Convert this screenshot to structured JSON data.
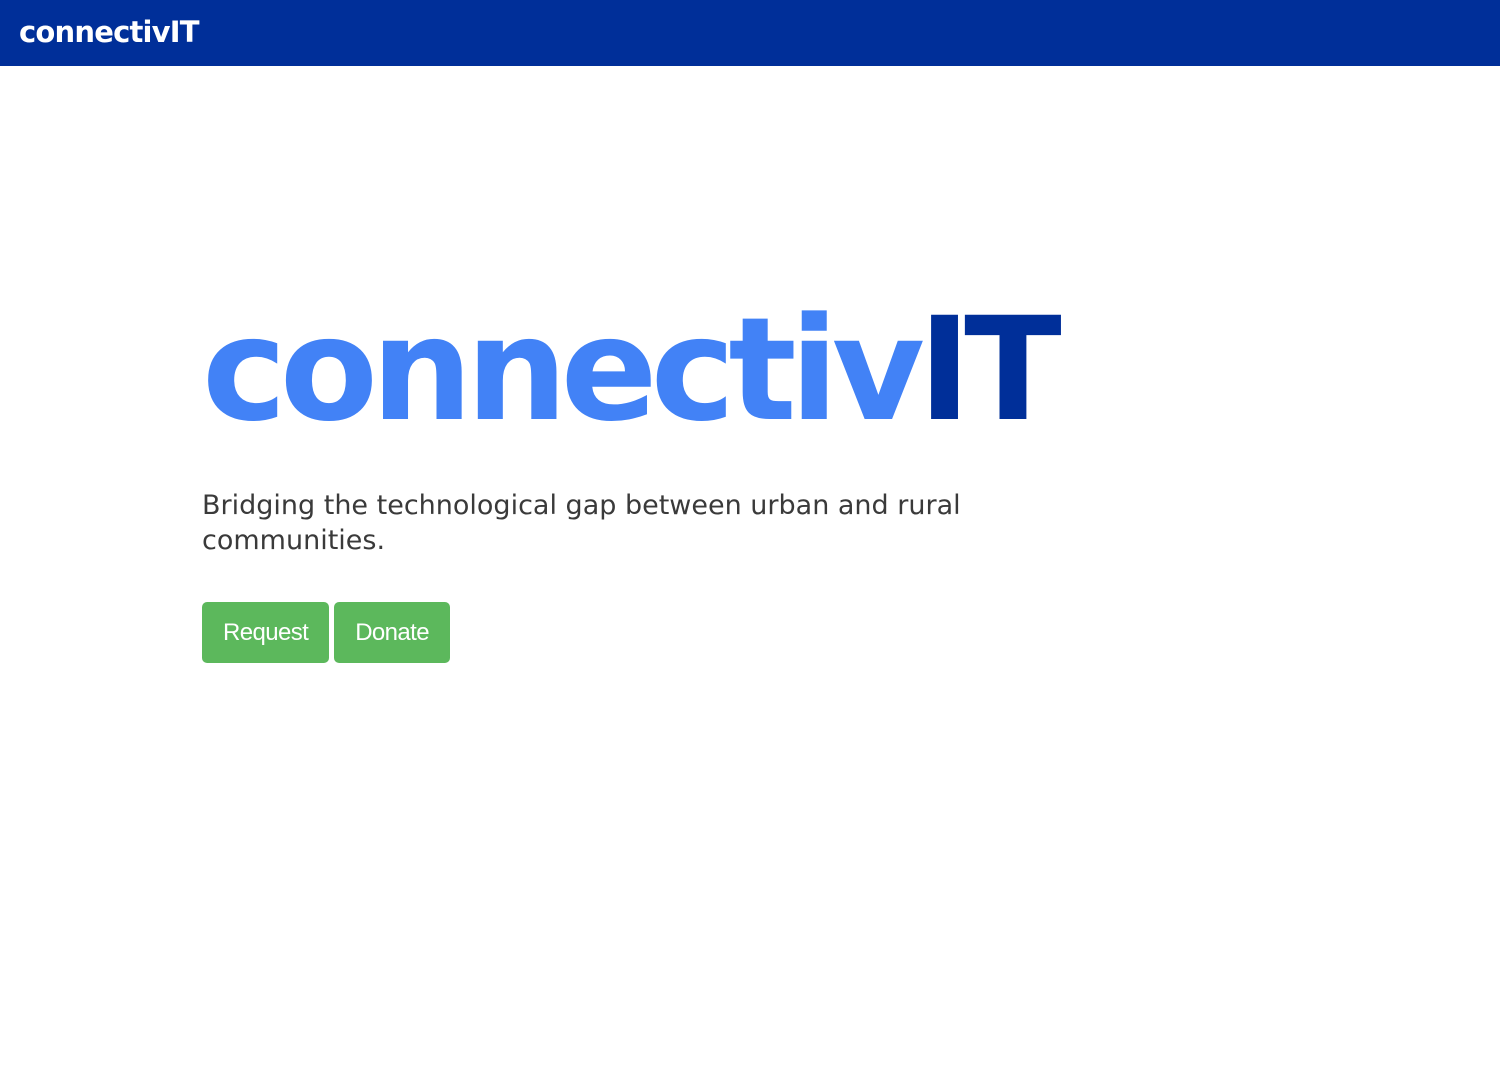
{
  "navbar": {
    "brand": "connectivIT",
    "background_color": "#002f99"
  },
  "hero": {
    "logo_part_1": "connectiv",
    "logo_part_2": "IT",
    "logo_color_1": "#4282f6",
    "logo_color_2": "#002f99",
    "tagline": "Bridging the technological gap between urban and rural communities."
  },
  "actions": {
    "request_label": "Request",
    "donate_label": "Donate",
    "button_color": "#5cb85c"
  }
}
